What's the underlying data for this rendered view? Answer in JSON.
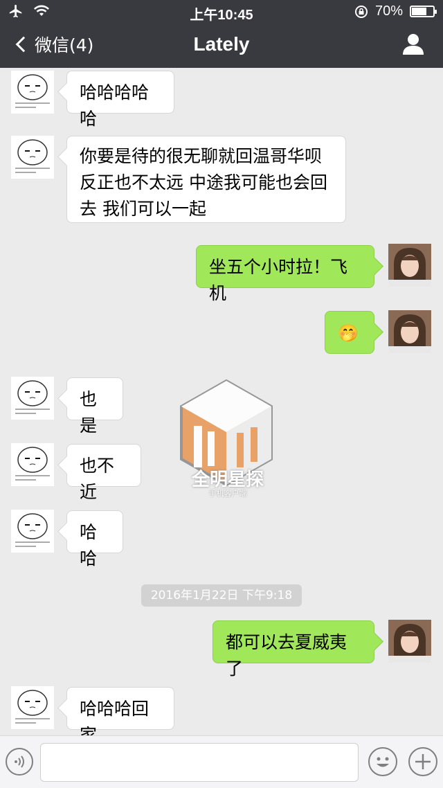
{
  "status_bar": {
    "time": "上午10:45",
    "battery": "70%",
    "battery_level": 0.7
  },
  "nav": {
    "back_label": "微信(4)",
    "title": "Lately"
  },
  "messages": [
    {
      "from": "them",
      "text": "哈哈哈哈哈"
    },
    {
      "from": "them",
      "lines": [
        "你要是待的很无聊就回温哥华呗",
        "反正也不太远 中途我可能也会回",
        "去 我们可以一起"
      ]
    },
    {
      "from": "me",
      "text": "坐五个小时拉！飞机"
    },
    {
      "from": "me",
      "text": "🤭"
    },
    {
      "from": "them",
      "text": "也是"
    },
    {
      "from": "them",
      "text": "也不近"
    },
    {
      "from": "them",
      "text": "哈哈"
    },
    {
      "from": "me",
      "text": "都可以去夏威夷了"
    },
    {
      "from": "them",
      "text": "哈哈哈回家"
    }
  ],
  "timestamp": "2016年1月22日 下午9:18",
  "watermark": {
    "title": "全明星探",
    "subtitle": "手机客户端"
  },
  "icons": {
    "airplane": "airplane-icon",
    "wifi": "wifi-icon",
    "lock": "rotation-lock-icon",
    "user": "user-icon",
    "voice": "voice-icon",
    "emoji": "emoji-icon",
    "plus": "plus-icon"
  },
  "colors": {
    "nav_bg": "#393a3f",
    "chat_bg": "#ebebeb",
    "outgoing_bubble": "#a0e75a",
    "incoming_bubble": "#ffffff"
  }
}
